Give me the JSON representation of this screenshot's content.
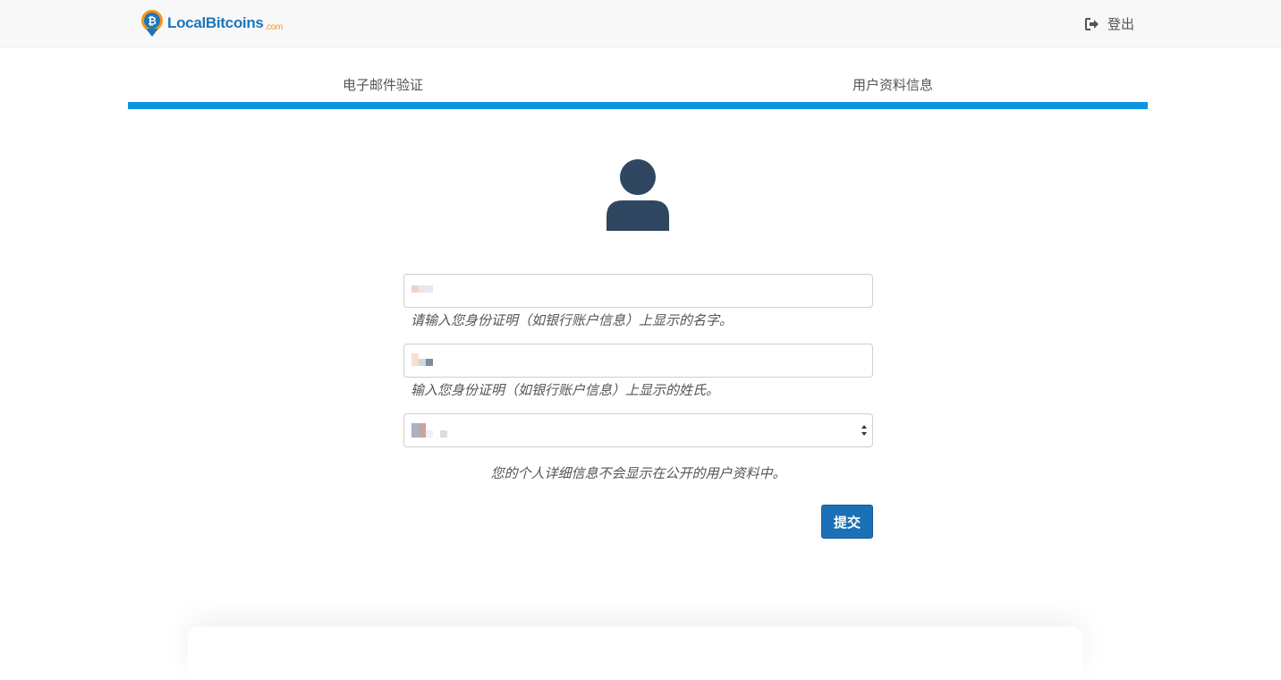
{
  "navbar": {
    "brand_name": "LocalBitcoins",
    "brand_suffix": ".com",
    "logout_label": "登出",
    "logout_icon": "sign-out-icon"
  },
  "steps": [
    {
      "label": "电子邮件验证"
    },
    {
      "label": "用户资料信息"
    }
  ],
  "progress_percent": 100,
  "colors": {
    "accent": "#0f95e0",
    "brand": "#1e76b9",
    "brand_suffix": "#f7931a",
    "button": "#1c70b7",
    "avatar": "#2f4760"
  },
  "form": {
    "first_name": {
      "value": "",
      "help": "请输入您身份证明（如银行账户信息）上显示的名字。"
    },
    "last_name": {
      "value": "",
      "help": "输入您身份证明（如银行账户信息）上显示的姓氏。"
    },
    "country_select": {
      "selected": ""
    },
    "privacy_notice": "您的个人详细信息不会显示在公开的用户资料中。",
    "submit_label": "提交"
  }
}
